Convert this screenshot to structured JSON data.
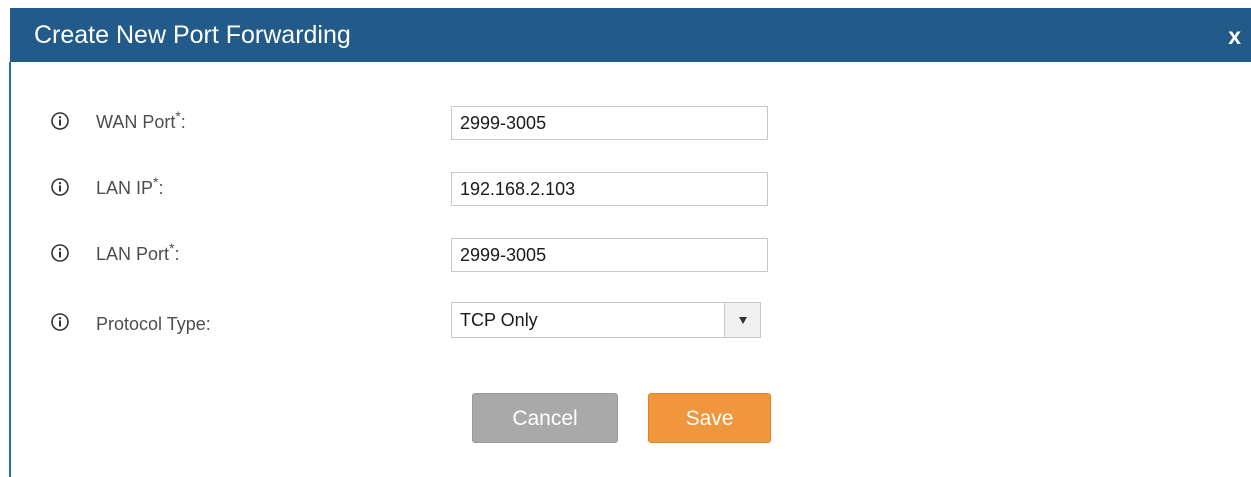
{
  "dialog": {
    "title": "Create New Port Forwarding",
    "close_label": "x"
  },
  "fields": [
    {
      "label": "WAN Port",
      "required_mark": "*",
      "suffix": ":",
      "value": "2999-3005"
    },
    {
      "label": "LAN IP",
      "required_mark": "*",
      "suffix": ":",
      "value": "192.168.2.103"
    },
    {
      "label": "LAN Port",
      "required_mark": "*",
      "suffix": ":",
      "value": "2999-3005"
    }
  ],
  "protocol": {
    "label": "Protocol Type:",
    "selected": "TCP Only"
  },
  "buttons": {
    "cancel": "Cancel",
    "save": "Save"
  },
  "colors": {
    "titlebar": "#225a8a",
    "save_button": "#f0963c",
    "cancel_button": "#a9a9a9"
  },
  "icons": {
    "info": "info-circle-icon",
    "dropdown": "chevron-down-icon"
  }
}
